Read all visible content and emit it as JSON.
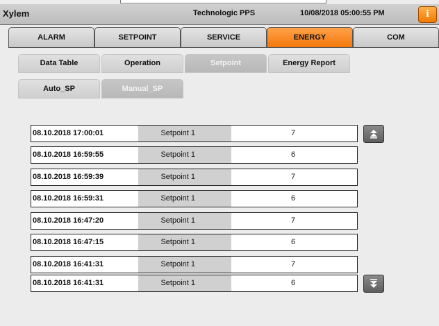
{
  "header": {
    "brand": "Xylem",
    "system": "Technologic PPS",
    "datetime": "10/08/2018 05:00:55 PM",
    "info_icon": "info-icon",
    "info_label": "i"
  },
  "main_nav": {
    "tabs": [
      {
        "label": "ALARM",
        "active": false
      },
      {
        "label": "SETPOINT",
        "active": false
      },
      {
        "label": "SERVICE",
        "active": false
      },
      {
        "label": "ENERGY",
        "active": true
      },
      {
        "label": "COM",
        "active": false
      }
    ]
  },
  "sub_nav": {
    "tabs": [
      {
        "label": "Data Table",
        "active": false
      },
      {
        "label": "Operation",
        "active": false
      },
      {
        "label": "Setpoint",
        "active": true
      },
      {
        "label": "Energy Report",
        "active": false
      }
    ]
  },
  "setpoint_nav": {
    "tabs": [
      {
        "label": "Auto_SP",
        "active": false
      },
      {
        "label": "Manual_SP",
        "active": true
      }
    ]
  },
  "log": {
    "rows": [
      {
        "timestamp": "08.10.2018 17:00:01",
        "name": "Setpoint 1",
        "value": "7"
      },
      {
        "timestamp": "08.10.2018 16:59:55",
        "name": "Setpoint 1",
        "value": "6"
      },
      {
        "timestamp": "08.10.2018 16:59:39",
        "name": "Setpoint 1",
        "value": "7"
      },
      {
        "timestamp": "08.10.2018 16:59:31",
        "name": "Setpoint 1",
        "value": "6"
      },
      {
        "timestamp": "08.10.2018 16:47:20",
        "name": "Setpoint 1",
        "value": "7"
      },
      {
        "timestamp": "08.10.2018 16:47:15",
        "name": "Setpoint 1",
        "value": "6"
      },
      {
        "timestamp": "08.10.2018 16:41:31",
        "name": "Setpoint 1",
        "value": "7"
      },
      {
        "timestamp": "08.10.2018 16:41:31",
        "name": "Setpoint 1",
        "value": "6"
      }
    ],
    "scroll_up_icon": "scroll-top-icon",
    "scroll_down_icon": "scroll-bottom-icon"
  },
  "colors": {
    "accent_active_tab": "#f5780a",
    "header_bg": "#c8c8c8",
    "background": "#ececec"
  }
}
